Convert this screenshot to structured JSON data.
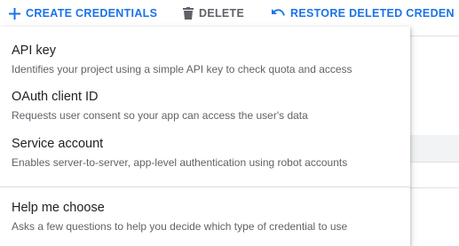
{
  "toolbar": {
    "create_label": "CREATE CREDENTIALS",
    "delete_label": "DELETE",
    "restore_label": "RESTORE DELETED CREDEN"
  },
  "menu": {
    "items": [
      {
        "title": "API key",
        "description": "Identifies your project using a simple API key to check quota and access"
      },
      {
        "title": "OAuth client ID",
        "description": "Requests user consent so your app can access the user's data"
      },
      {
        "title": "Service account",
        "description": "Enables server-to-server, app-level authentication using robot accounts"
      },
      {
        "title": "Help me choose",
        "description": "Asks a few questions to help you decide which type of credential to use"
      }
    ]
  },
  "colors": {
    "accent": "#1a73e8",
    "muted": "#5f6368",
    "text": "#202124"
  },
  "icons": {
    "create": "plus-icon",
    "delete": "trash-icon",
    "restore": "undo-icon"
  }
}
